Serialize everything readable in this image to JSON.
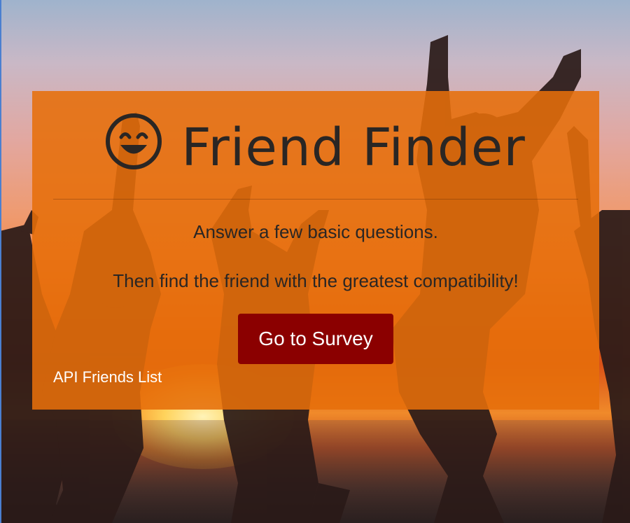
{
  "header": {
    "title": "Friend Finder",
    "title_icon": "smiley-icon"
  },
  "main": {
    "lead_line_1": "Answer a few basic questions.",
    "lead_line_2": "Then find the friend with the greatest compatibility!",
    "survey_button_label": "Go to Survey",
    "api_link_label": "API Friends List"
  },
  "colors": {
    "panel": "#e66e0a",
    "button": "#8b0000",
    "title_text": "#2a2624"
  }
}
